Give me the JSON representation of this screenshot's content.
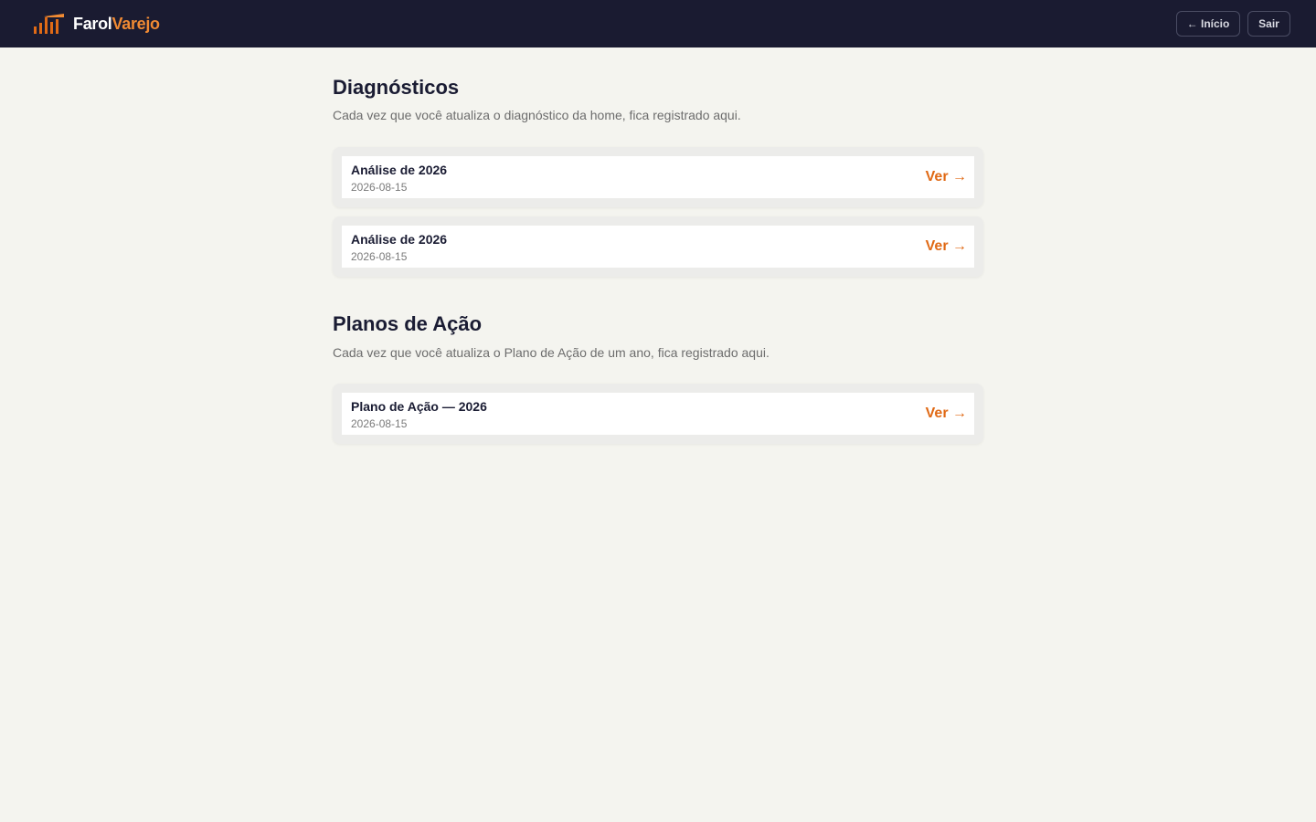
{
  "header": {
    "brand_part1": "Farol",
    "brand_part2": "Varejo",
    "home_label": "← Início",
    "exit_label": "Sair",
    "logo_icon": "lighthouse-bars-icon",
    "colors": {
      "bar": "#1a1b31",
      "accent": "#f08a33"
    }
  },
  "diagnostics": {
    "title": "Diagnósticos",
    "description": "Cada vez que você atualiza o diagnóstico da home, fica registrado aqui.",
    "items": [
      {
        "title": "Análise de 2026",
        "date": "2026-08-15",
        "link": "Ver →"
      },
      {
        "title": "Análise de 2026",
        "date": "2026-08-15",
        "link": "Ver →"
      }
    ]
  },
  "action_plans": {
    "title": "Planos de Ação",
    "description": "Cada vez que você atualiza o Plano de Ação de um ano, fica registrado aqui.",
    "items": [
      {
        "title": "Plano de Ação — 2026",
        "date": "2026-08-15",
        "link": "Ver →"
      }
    ]
  },
  "colors": {
    "background": "#f4f4ef",
    "link": "#e06a16",
    "text": "#1a1c33"
  }
}
